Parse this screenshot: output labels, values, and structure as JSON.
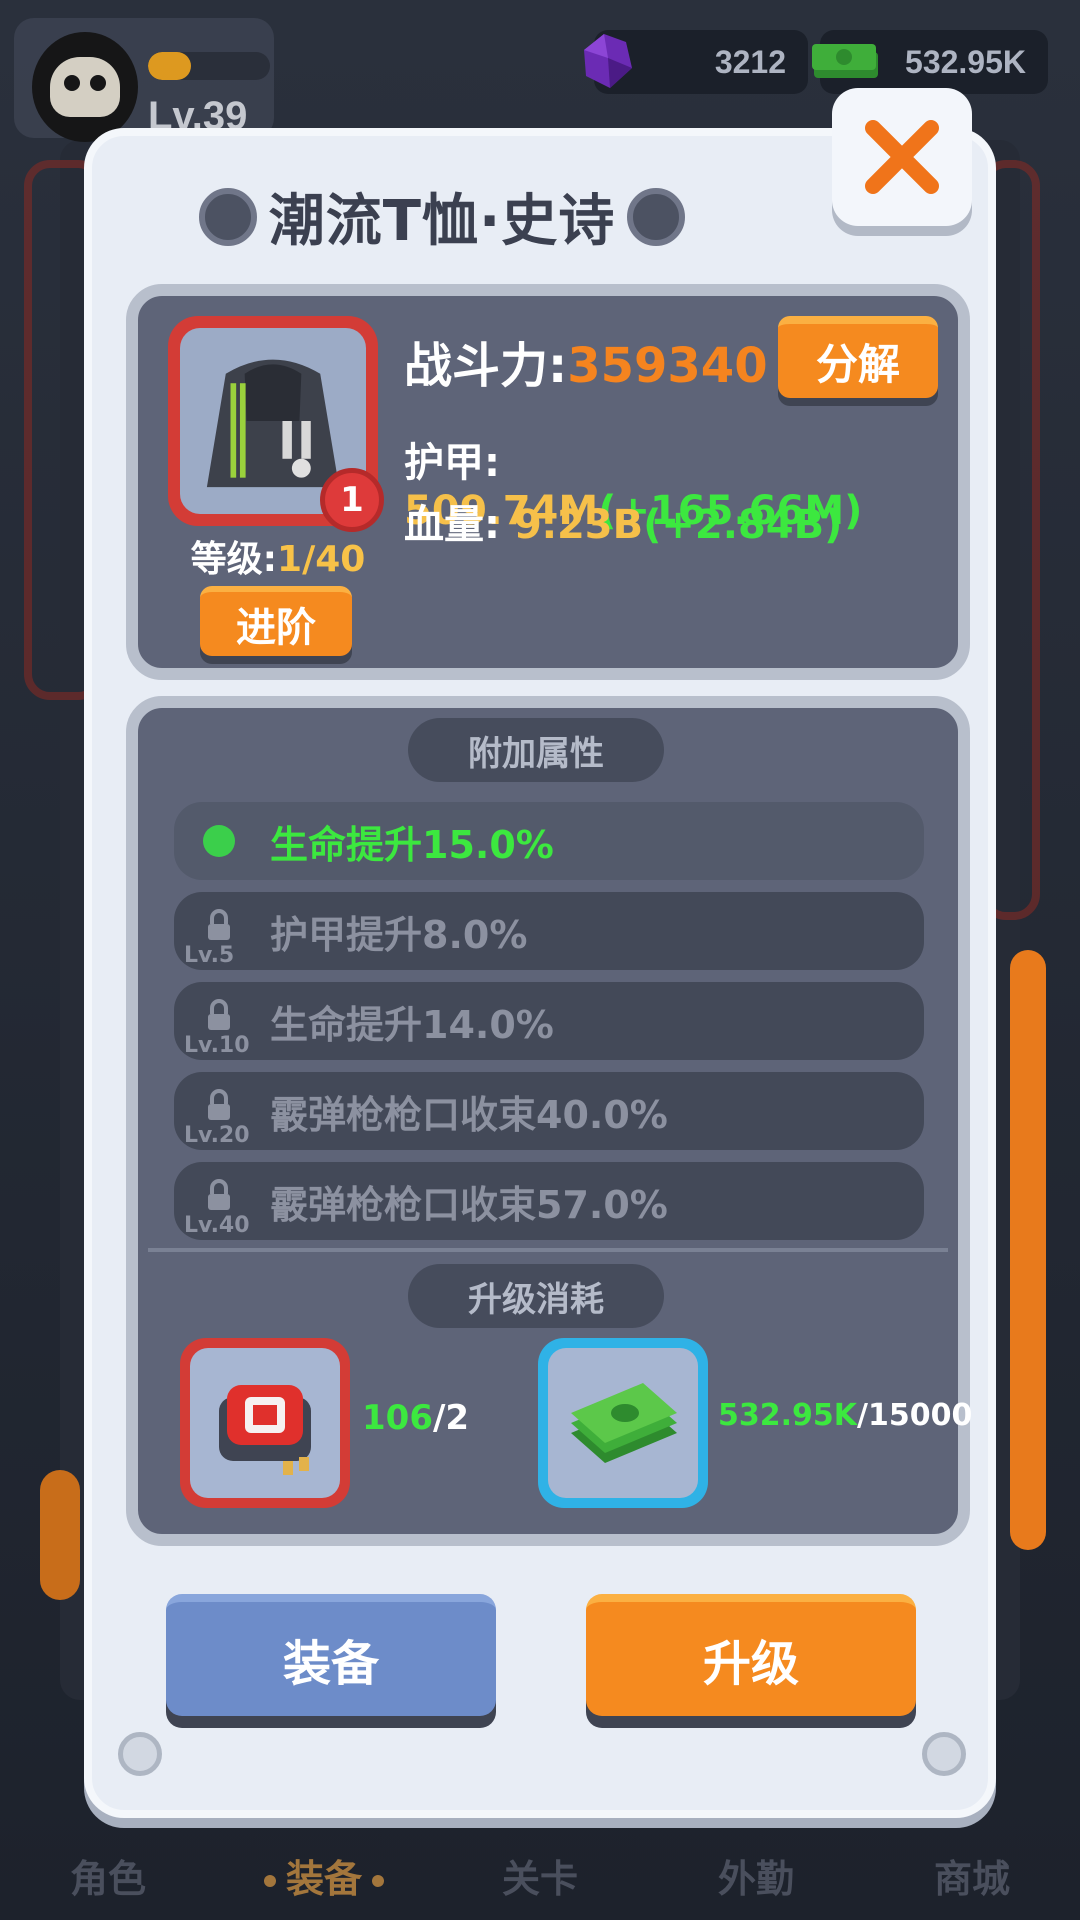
{
  "player": {
    "level_label": "Lv.39",
    "xp_fill_percent": 35
  },
  "currency": {
    "gems": "3212",
    "cash": "532.95K"
  },
  "dialog": {
    "title": "潮流T恤·史诗",
    "close_icon": "close-icon"
  },
  "item": {
    "badge": "1",
    "grade_label": "等级:",
    "grade_value": "1/40",
    "advance_label": "进阶"
  },
  "stats": {
    "power_label": "战斗力:",
    "power_value": "359340",
    "decompose_label": "分解",
    "armor_label": "护甲:",
    "armor_value": "509.74M",
    "armor_bonus": "(+165.66M)",
    "hp_label": "血量:",
    "hp_value": "9.23B",
    "hp_bonus": "(+2.84B)"
  },
  "attributes": {
    "title": "附加属性",
    "rows": [
      {
        "text": "生命提升15.0%",
        "lock_level": "",
        "unlocked": true
      },
      {
        "text": "护甲提升8.0%",
        "lock_level": "Lv.5",
        "unlocked": false
      },
      {
        "text": "生命提升14.0%",
        "lock_level": "Lv.10",
        "unlocked": false
      },
      {
        "text": "霰弹枪枪口收束40.0%",
        "lock_level": "Lv.20",
        "unlocked": false
      },
      {
        "text": "霰弹枪枪口收束57.0%",
        "lock_level": "Lv.40",
        "unlocked": false
      }
    ]
  },
  "upgrade_cost": {
    "title": "升级消耗",
    "chip_have": "106",
    "chip_need": "/2",
    "cash_have": "532.95K",
    "cash_need": "/15000"
  },
  "actions": {
    "equip": "装备",
    "upgrade": "升级"
  },
  "nav": {
    "items": [
      "角色",
      "装备",
      "关卡",
      "外勤",
      "商城"
    ]
  },
  "colors": {
    "accent_orange": "#f58a1f",
    "green": "#3ce83f",
    "gold": "#f6c04a",
    "equip_blue": "#6d8cc9"
  }
}
